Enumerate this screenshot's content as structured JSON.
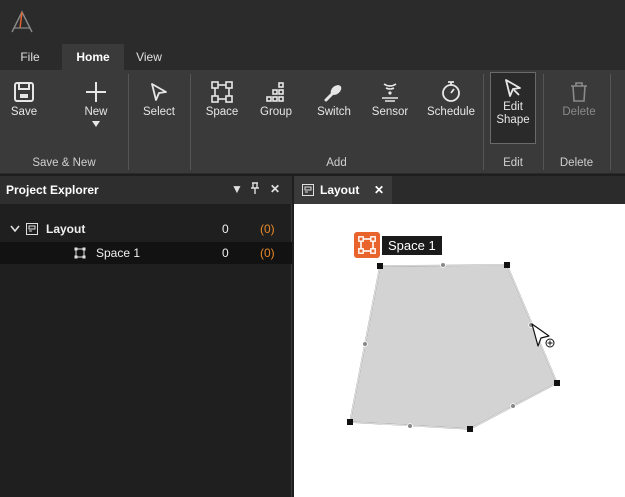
{
  "menu": {
    "tabs": [
      "File",
      "Home",
      "View"
    ],
    "active": "Home"
  },
  "ribbon": {
    "buttons": {
      "save": "Save",
      "new_line1": "New",
      "select": "Select",
      "space": "Space",
      "group": "Group",
      "switch": "Switch",
      "sensor": "Sensor",
      "schedule": "Schedule",
      "edit_line1": "Edit",
      "edit_line2": "Shape",
      "delete": "Delete"
    },
    "groups": {
      "save_new": "Save & New",
      "add": "Add",
      "edit": "Edit",
      "delete": "Delete"
    }
  },
  "explorer": {
    "title": "Project Explorer",
    "items": [
      {
        "label": "Layout",
        "count": "0",
        "alert": "(0)"
      },
      {
        "label": "Space 1",
        "count": "0",
        "alert": "(0)"
      }
    ]
  },
  "document": {
    "tab_label": "Layout",
    "space_label": "Space 1"
  },
  "colors": {
    "accent": "#e8642c",
    "alert": "#e8892c",
    "shape_fill": "#d3d3d3"
  },
  "icons": {
    "app": "app-logo-icon",
    "pointer": "cursor-move-icon"
  }
}
